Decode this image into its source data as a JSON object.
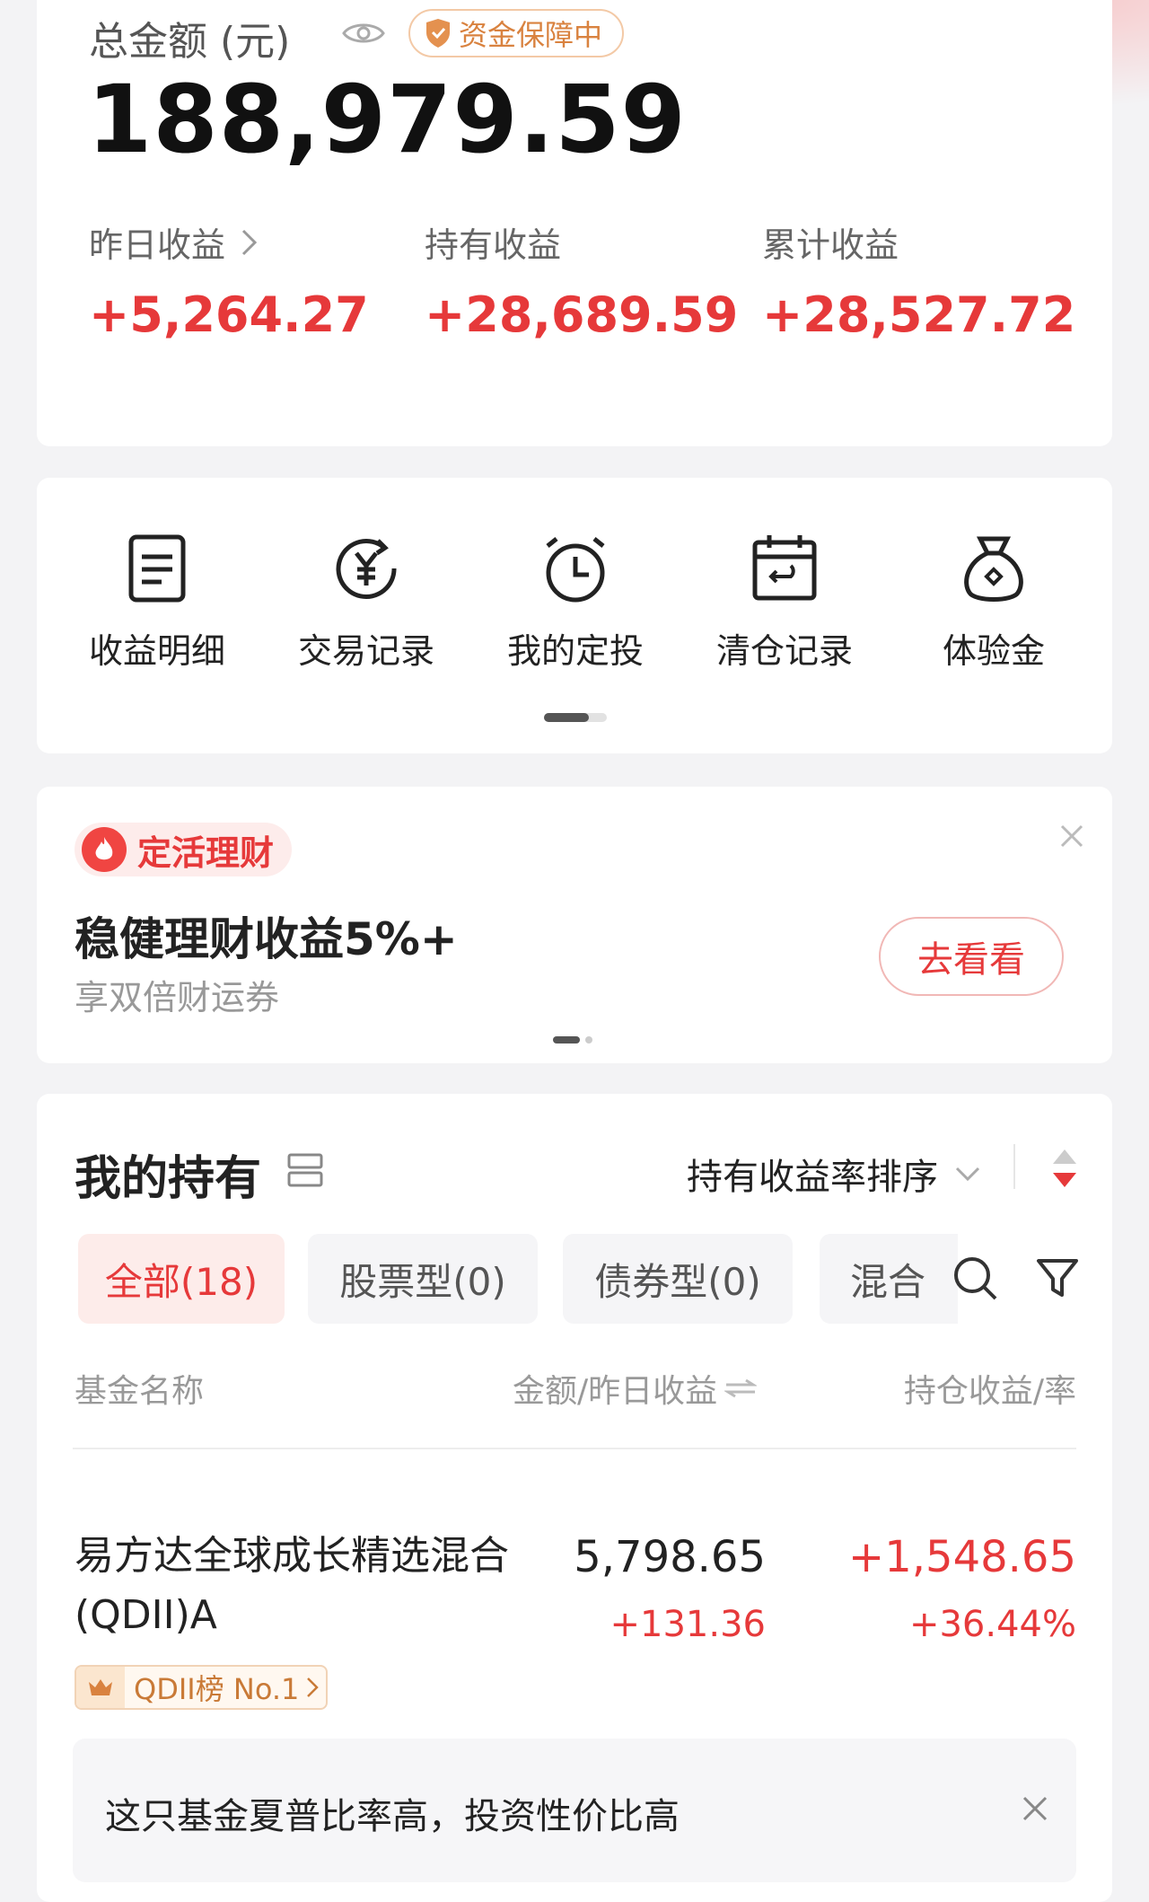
{
  "summary": {
    "total_label": "总金额 (元)",
    "guarantee_badge": "资金保障中",
    "total_amount": "188,979.59",
    "stats": [
      {
        "label": "昨日收益",
        "value": "+5,264.27"
      },
      {
        "label": "持有收益",
        "value": "+28,689.59"
      },
      {
        "label": "累计收益",
        "value": "+28,527.72"
      }
    ]
  },
  "tools": [
    {
      "label": "收益明细",
      "icon": "document-icon"
    },
    {
      "label": "交易记录",
      "icon": "yuan-cycle-icon"
    },
    {
      "label": "我的定投",
      "icon": "alarm-clock-icon"
    },
    {
      "label": "清仓记录",
      "icon": "calendar-return-icon"
    },
    {
      "label": "体验金",
      "icon": "money-bag-icon"
    }
  ],
  "promo": {
    "tag": "定活理财",
    "title": "稳健理财收益5%+",
    "subtitle": "享双倍财运券",
    "button": "去看看"
  },
  "holdings": {
    "title": "我的持有",
    "sort_label": "持有收益率排序",
    "filters": [
      "全部(18)",
      "股票型(0)",
      "债券型(0)",
      "混合"
    ],
    "columns": {
      "name": "基金名称",
      "amount": "金额/昨日收益",
      "profit": "持仓收益/率"
    },
    "funds": [
      {
        "name": "易方达全球成长精选混合(QDII)A",
        "amount": "5,798.65",
        "yesterday": "+131.36",
        "profit": "+1,548.65",
        "rate": "+36.44%",
        "badge": "QDII榜 No.1"
      }
    ],
    "tip": "这只基金夏普比率高，投资性价比高"
  },
  "colors": {
    "accent_red": "#e6393a",
    "badge_orange": "#d9823f"
  }
}
